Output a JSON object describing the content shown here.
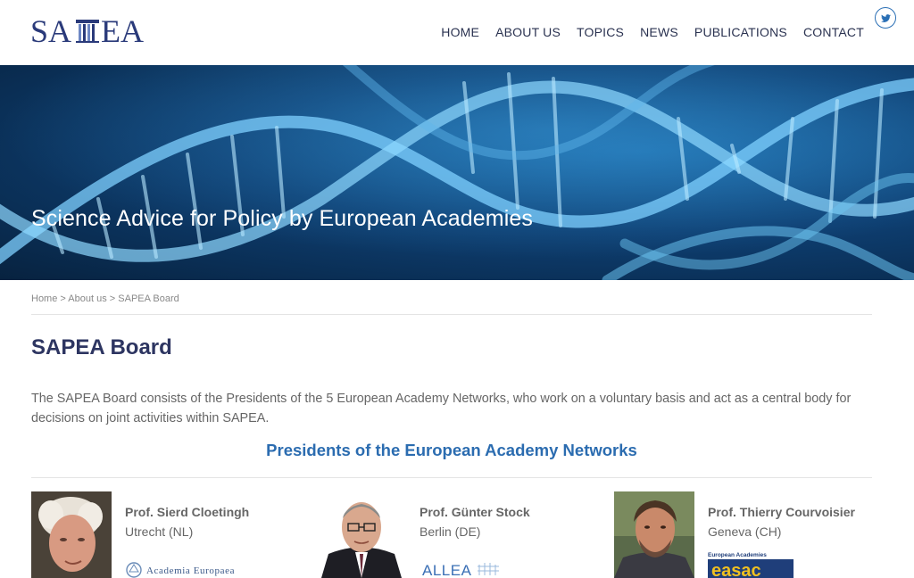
{
  "header": {
    "logo_text": "SAPEA",
    "nav": [
      {
        "label": "HOME"
      },
      {
        "label": "ABOUT US"
      },
      {
        "label": "TOPICS"
      },
      {
        "label": "NEWS"
      },
      {
        "label": "PUBLICATIONS"
      },
      {
        "label": "CONTACT"
      }
    ],
    "social_icon": "twitter-icon"
  },
  "hero": {
    "title": "Science Advice for Policy by European Academies"
  },
  "breadcrumb": {
    "items": [
      "Home",
      "About us",
      "SAPEA Board"
    ],
    "separator": ">"
  },
  "page": {
    "title": "SAPEA Board",
    "intro": "The SAPEA Board consists of the Presidents of the 5 European Academy Networks, who work on a voluntary basis and act as a central body for decisions on joint activities within SAPEA.",
    "section_title": "Presidents of the European Academy Networks"
  },
  "presidents": [
    {
      "name": "Prof. Sierd Cloetingh",
      "location": "Utrecht (NL)",
      "network_logo": "Academia Europaea"
    },
    {
      "name": "Prof. Günter Stock",
      "location": "Berlin (DE)",
      "network_logo": "ALLEA"
    },
    {
      "name": "Prof. Thierry Courvoisier",
      "location": "Geneva (CH)",
      "network_logo_caption": "European Academies",
      "network_logo": "easac"
    }
  ],
  "colors": {
    "brand_navy": "#2d3561",
    "section_blue": "#2b6cb0",
    "hero_dark": "#07223f",
    "hero_light": "#1c6aa8"
  }
}
